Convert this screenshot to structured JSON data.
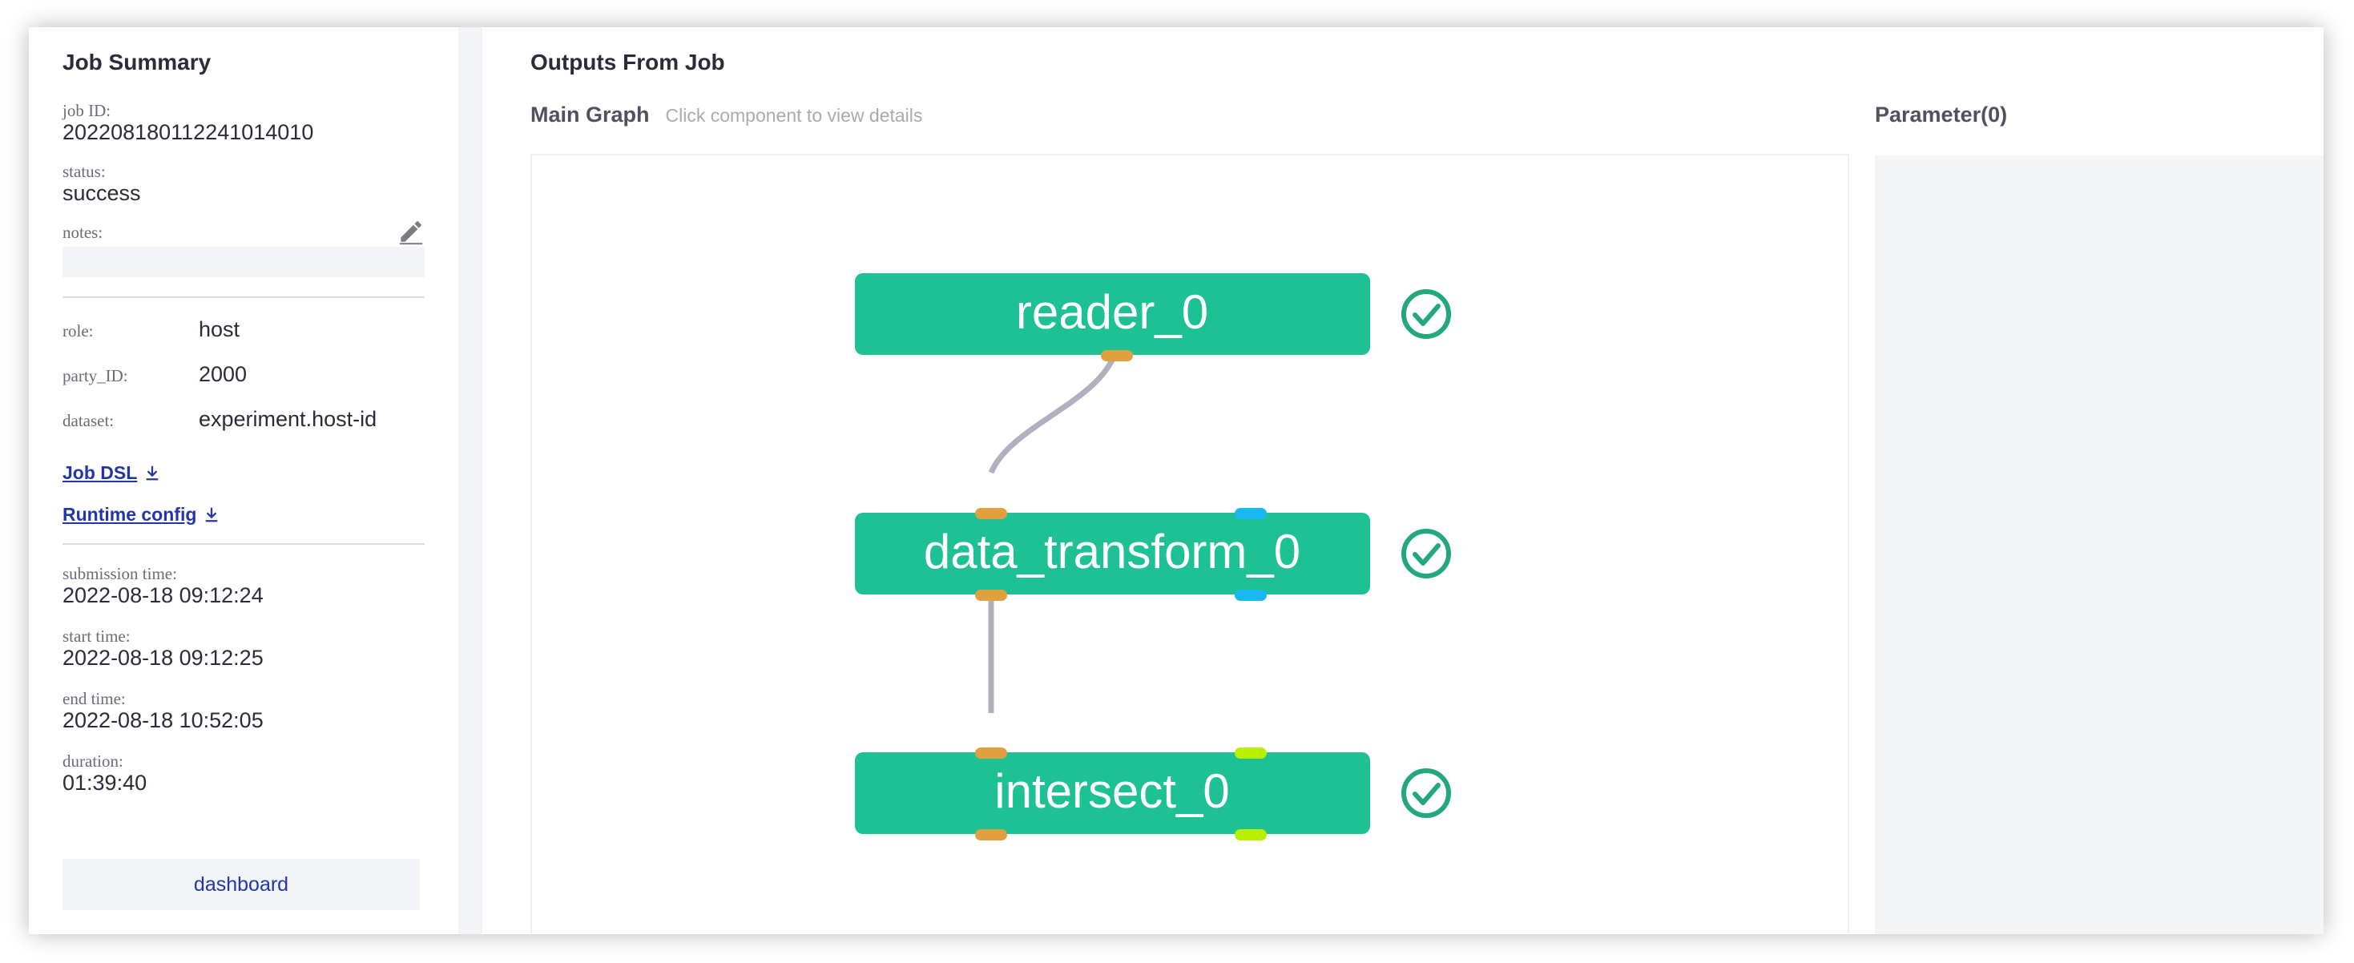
{
  "summary": {
    "title": "Job Summary",
    "job_id_label": "job ID:",
    "job_id": "202208180112241014010",
    "status_label": "status:",
    "status": "success",
    "notes_label": "notes:",
    "notes": "",
    "role_label": "role:",
    "role": "host",
    "party_id_label": "party_ID:",
    "party_id": "2000",
    "dataset_label": "dataset:",
    "dataset": "experiment.host-id",
    "job_dsl_link": "Job DSL",
    "runtime_config_link": "Runtime config",
    "submission_time_label": "submission time:",
    "submission_time": "2022-08-18 09:12:24",
    "start_time_label": "start time:",
    "start_time": "2022-08-18 09:12:25",
    "end_time_label": "end time:",
    "end_time": "2022-08-18 10:52:05",
    "duration_label": "duration:",
    "duration": "01:39:40",
    "dashboard_button": "dashboard"
  },
  "outputs": {
    "title": "Outputs From Job",
    "graph_title": "Main Graph",
    "graph_hint": "Click component to view details",
    "parameter_title": "Parameter(0)"
  },
  "graph": {
    "nodes": [
      {
        "id": "reader_0",
        "label": "reader_0",
        "status": "success"
      },
      {
        "id": "data_transform_0",
        "label": "data_transform_0",
        "status": "success"
      },
      {
        "id": "intersect_0",
        "label": "intersect_0",
        "status": "success"
      }
    ],
    "edges": [
      {
        "from": "reader_0",
        "to": "data_transform_0",
        "kind": "data"
      },
      {
        "from": "data_transform_0",
        "to": "intersect_0",
        "kind": "data"
      }
    ],
    "icons": {
      "status_check": "check-circle-icon",
      "edit": "pencil-icon",
      "download": "download-icon"
    },
    "colors": {
      "node": "#1dc194",
      "data_port": "#e0a040",
      "model_port": "#1ab8f0",
      "cache_port": "#b8f000",
      "edge": "#b0b0c0",
      "check": "#23a87a",
      "link": "#2336a8"
    }
  }
}
